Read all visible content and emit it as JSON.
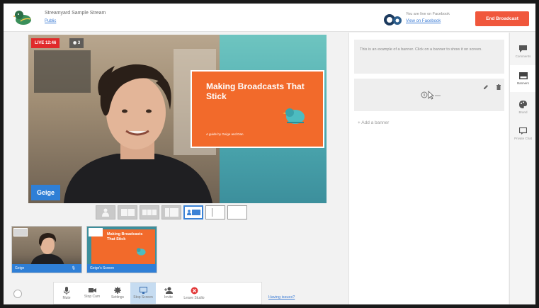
{
  "header": {
    "stream_title": "Streamyard Sample Stream",
    "visibility": "Public",
    "live_note": "You are live on Facebook",
    "view_link": "View on Facebook",
    "end_button": "End Broadcast"
  },
  "stage": {
    "live_badge": "LIVE 12:46",
    "viewers": "3",
    "slide_title": "Making Broadcasts That Stick",
    "slide_subtitle": "A guide by Geige and Dan",
    "name_tag": "Geige"
  },
  "layouts": [
    "solo",
    "two-up",
    "group",
    "thin",
    "screen-share-selected",
    "sidebar",
    "blank"
  ],
  "thumbnails": [
    {
      "label": "Geige"
    },
    {
      "label": "Geige's Screen",
      "slide_title": "Making Broadcasts That Stick"
    }
  ],
  "toolbar": {
    "items": [
      {
        "label": "Mute",
        "icon": "microphone-icon",
        "active": false
      },
      {
        "label": "Stop Cam",
        "icon": "camera-icon",
        "active": false
      },
      {
        "label": "Settings",
        "icon": "gear-icon",
        "active": false
      },
      {
        "label": "Stop Screen",
        "icon": "monitor-icon",
        "active": true
      },
      {
        "label": "Invite",
        "icon": "add-user-icon",
        "active": false
      },
      {
        "label": "Leave Studio",
        "icon": "leave-icon",
        "active": false
      }
    ],
    "help_link": "Having issues?"
  },
  "right_panel": {
    "hint": "This is an example of a banner. Click on a banner to show it on screen.",
    "add_banner": "+ Add a banner"
  },
  "sidebar": {
    "items": [
      {
        "label": "Comments",
        "icon": "comment-icon"
      },
      {
        "label": "Banners",
        "icon": "banner-icon",
        "active": true
      },
      {
        "label": "Brand",
        "icon": "palette-icon"
      },
      {
        "label": "Private Chat",
        "icon": "chat-icon"
      }
    ]
  },
  "colors": {
    "accent": "#2f7fd6",
    "end_broadcast": "#f0573c",
    "live": "#e02b2b",
    "slide": "#f26a2b",
    "teal": "#4da9b0"
  }
}
